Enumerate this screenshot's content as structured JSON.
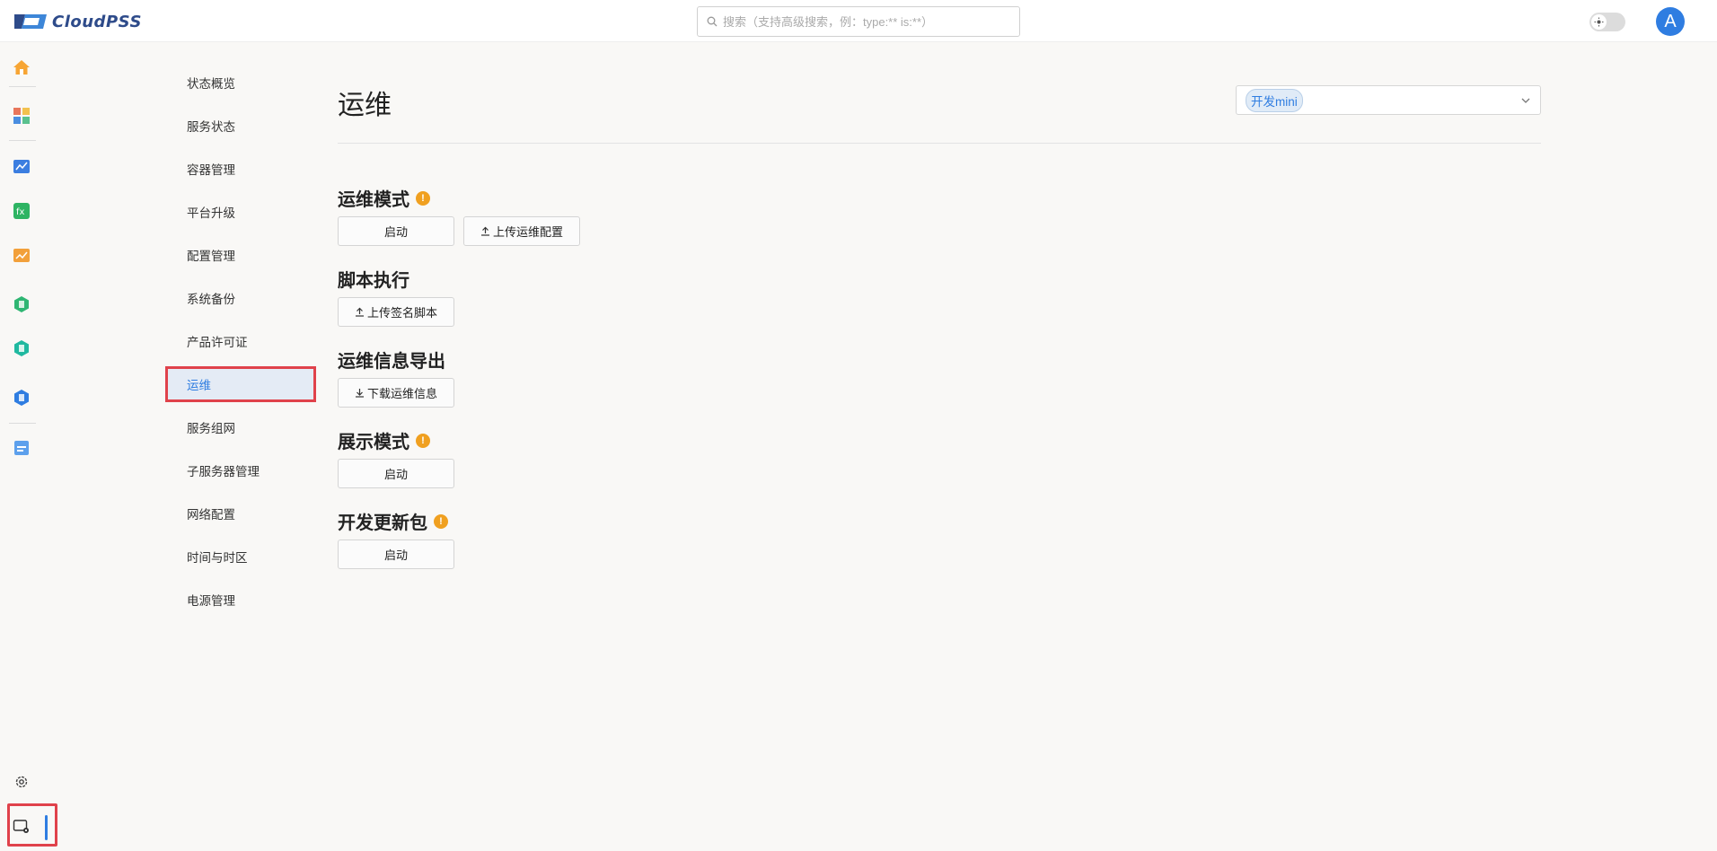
{
  "app": {
    "name": "CloudPSS"
  },
  "search": {
    "placeholder": "搜索（支持高级搜索，例：type:** is:**）"
  },
  "user": {
    "avatar_letter": "A"
  },
  "subnav": {
    "items": [
      {
        "label": "状态概览"
      },
      {
        "label": "服务状态"
      },
      {
        "label": "容器管理"
      },
      {
        "label": "平台升级"
      },
      {
        "label": "配置管理"
      },
      {
        "label": "系统备份"
      },
      {
        "label": "产品许可证"
      },
      {
        "label": "运维",
        "active": true
      },
      {
        "label": "服务组网"
      },
      {
        "label": "子服务器管理"
      },
      {
        "label": "网络配置"
      },
      {
        "label": "时间与时区"
      },
      {
        "label": "电源管理"
      }
    ]
  },
  "main": {
    "title": "运维",
    "environment": {
      "selected": "开发mini"
    },
    "sections": [
      {
        "title": "运维模式",
        "warning": true,
        "buttons": [
          "启动",
          "上传运维配置"
        ]
      },
      {
        "title": "脚本执行",
        "warning": false,
        "buttons": [
          "上传签名脚本"
        ]
      },
      {
        "title": "运维信息导出",
        "warning": false,
        "buttons": [
          "下载运维信息"
        ]
      },
      {
        "title": "展示模式",
        "warning": true,
        "buttons": [
          "启动"
        ]
      },
      {
        "title": "开发更新包",
        "warning": true,
        "buttons": [
          "启动"
        ]
      }
    ]
  },
  "rail": {
    "icons": [
      "home-icon",
      "apps-icon",
      "simstudio-icon",
      "function-icon",
      "analysis-icon",
      "app-green-icon",
      "app-cyan-icon",
      "app-blue-icon",
      "document-icon",
      "settings-icon",
      "admin-console-icon"
    ]
  },
  "colors": {
    "accent": "#2f7de1",
    "highlight": "#e0424b",
    "warning": "#f0a020",
    "brand": "#2e4b8a"
  }
}
